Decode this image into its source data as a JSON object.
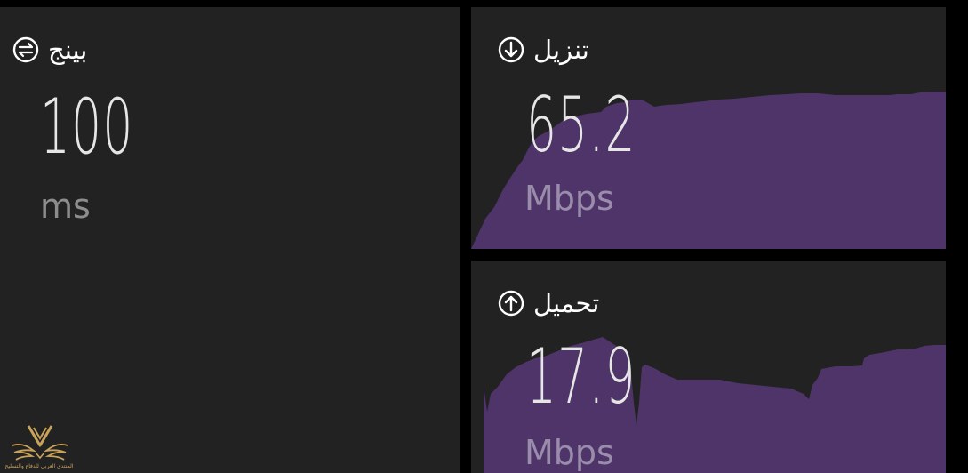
{
  "ping": {
    "label": "بينج",
    "icon": "ping-icon",
    "value": "100",
    "unit": "ms"
  },
  "download": {
    "label": "تنزيل",
    "icon": "arrow-down-circle-icon",
    "value": "65.2",
    "unit": "Mbps"
  },
  "upload": {
    "label": "تحميل",
    "icon": "arrow-up-circle-icon",
    "value": "17.9",
    "unit": "Mbps"
  },
  "colors": {
    "background": "#000000",
    "panel": "#222222",
    "graph_fill": "#4e3468"
  },
  "watermark": {
    "icon": "winged-shield-logo",
    "caption": "المنتدى العربي للدفاع والتسليح"
  }
}
